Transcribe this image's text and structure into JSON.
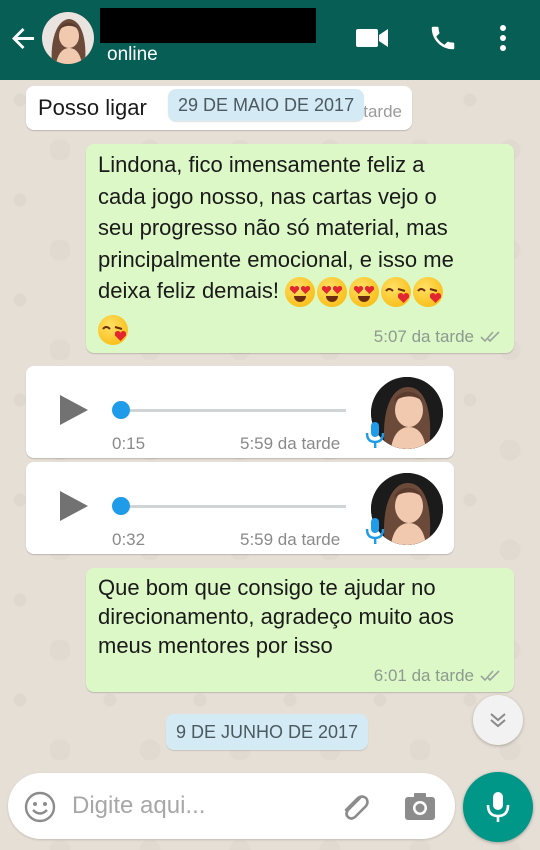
{
  "header": {
    "status": "online",
    "color": "#075e54"
  },
  "messages": {
    "first": {
      "text": "Posso ligar",
      "visible_time": "tarde"
    },
    "date1": "29 DE MAIO DE 2017",
    "msg2": {
      "lines": [
        "Lindona, fico imensamente feliz a",
        "cada jogo nosso, nas cartas vejo o",
        "seu progresso não só material, mas",
        "principalmente emocional, e isso me",
        "deixa feliz demais!"
      ],
      "time": "5:07 da tarde",
      "emojis": [
        "heart-eyes-emoji",
        "heart-eyes-emoji",
        "heart-eyes-emoji",
        "kissing-heart-emoji",
        "kissing-heart-emoji",
        "kissing-heart-emoji"
      ]
    },
    "voice1": {
      "duration": "0:15",
      "time": "5:59 da tarde"
    },
    "voice2": {
      "duration": "0:32",
      "time": "5:59 da tarde"
    },
    "msg3": {
      "lines": [
        "Que bom que consigo te ajudar no",
        "direcionamento, agradeço muito aos",
        "meus mentores por isso"
      ],
      "time": "6:01 da tarde"
    },
    "date2": "9 DE JUNHO DE 2017"
  },
  "input": {
    "placeholder": "Digite aqui..."
  },
  "colors": {
    "outgoing_bubble": "#dcf8c6",
    "incoming_bubble": "#ffffff",
    "date_chip": "#d4eaf4",
    "accent": "#009688",
    "audio_knob": "#1e9be9"
  },
  "icons": [
    "back-arrow-icon",
    "video-call-icon",
    "phone-icon",
    "more-vert-icon",
    "play-icon",
    "mic-icon",
    "double-check-icon",
    "scroll-down-icon",
    "emoji-icon",
    "attach-icon",
    "camera-icon"
  ]
}
